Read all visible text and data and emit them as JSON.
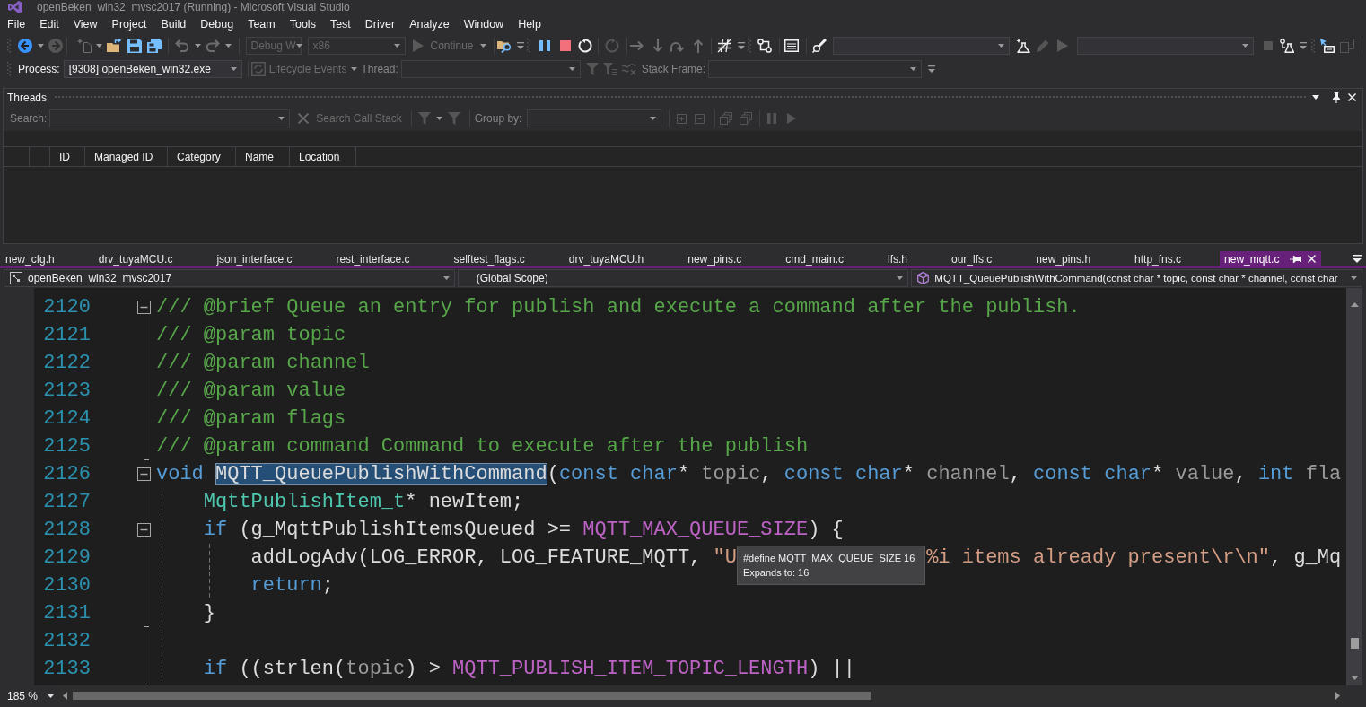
{
  "window": {
    "title": "openBeken_win32_mvsc2017 (Running) - Microsoft Visual Studio"
  },
  "menu": [
    "File",
    "Edit",
    "View",
    "Project",
    "Build",
    "Debug",
    "Team",
    "Tools",
    "Test",
    "Driver",
    "Analyze",
    "Window",
    "Help"
  ],
  "toolbar": {
    "configuration": {
      "value": "Debug W",
      "disabled": true
    },
    "platform": {
      "value": "x86",
      "disabled": true
    },
    "continue": {
      "label": "Continue",
      "disabled": true
    }
  },
  "debug_location": {
    "process": {
      "label": "Process:",
      "value": "[9308] openBeken_win32.exe",
      "disabled": false
    },
    "lifecycle_events": {
      "label": "Lifecycle Events",
      "disabled": true
    },
    "thread": {
      "label": "Thread:",
      "disabled": true
    },
    "stack_frame": {
      "label": "Stack Frame:",
      "disabled": true
    }
  },
  "threads": {
    "title": "Threads",
    "search": {
      "label": "Search:",
      "disabled": true
    },
    "search_call_stack": {
      "label": "Search Call Stack",
      "disabled": true
    },
    "group_by": {
      "label": "Group by:",
      "disabled": true
    },
    "columns": [
      "ID",
      "Managed ID",
      "Category",
      "Name",
      "Location"
    ]
  },
  "tabs": [
    {
      "label": "new_cfg.h",
      "selected": false
    },
    {
      "label": "drv_tuyaMCU.c",
      "selected": false
    },
    {
      "label": "json_interface.c",
      "selected": false
    },
    {
      "label": "rest_interface.c",
      "selected": false
    },
    {
      "label": "selftest_flags.c",
      "selected": false
    },
    {
      "label": "drv_tuyaMCU.h",
      "selected": false
    },
    {
      "label": "new_pins.c",
      "selected": false
    },
    {
      "label": "cmd_main.c",
      "selected": false
    },
    {
      "label": "lfs.h",
      "selected": false
    },
    {
      "label": "our_lfs.c",
      "selected": false
    },
    {
      "label": "new_pins.h",
      "selected": false
    },
    {
      "label": "http_fns.c",
      "selected": false
    },
    {
      "label": "new_mqtt.c",
      "selected": true
    }
  ],
  "navigation": {
    "project": "openBeken_win32_mvsc2017",
    "scope": "(Global Scope)",
    "member": "MQTT_QueuePublishWithCommand(const char * topic, const char * channel, const char"
  },
  "editor": {
    "tooltip": {
      "lines": [
        "#define MQTT_MAX_QUEUE_SIZE 16",
        "Expands to: 16"
      ]
    },
    "lines": [
      {
        "number": "2120",
        "fold_start": true,
        "fold_end": false,
        "tokens": [
          {
            "kind": "comment",
            "text": "/// @brief Queue an entry for publish and execute a command after the publish."
          }
        ]
      },
      {
        "number": "2121",
        "fold_start": false,
        "fold_end": false,
        "tokens": [
          {
            "kind": "comment",
            "text": "/// @param topic"
          }
        ]
      },
      {
        "number": "2122",
        "fold_start": false,
        "fold_end": false,
        "tokens": [
          {
            "kind": "comment",
            "text": "/// @param channel"
          }
        ]
      },
      {
        "number": "2123",
        "fold_start": false,
        "fold_end": false,
        "tokens": [
          {
            "kind": "comment",
            "text": "/// @param value"
          }
        ]
      },
      {
        "number": "2124",
        "fold_start": false,
        "fold_end": false,
        "tokens": [
          {
            "kind": "comment",
            "text": "/// @param flags"
          }
        ]
      },
      {
        "number": "2125",
        "fold_start": false,
        "fold_end": true,
        "tokens": [
          {
            "kind": "comment",
            "text": "/// @param command Command to execute after the publish"
          }
        ]
      },
      {
        "number": "2126",
        "fold_start": true,
        "fold_end": false,
        "tokens": [
          {
            "kind": "keyword",
            "text": "void "
          },
          {
            "kind": "function",
            "text": "MQTT_QueuePublishWithCommand",
            "highlighted": true
          },
          {
            "kind": "plain",
            "text": "("
          },
          {
            "kind": "keyword",
            "text": "const char"
          },
          {
            "kind": "plain",
            "text": "* "
          },
          {
            "kind": "param",
            "text": "topic"
          },
          {
            "kind": "plain",
            "text": ", "
          },
          {
            "kind": "keyword",
            "text": "const char"
          },
          {
            "kind": "plain",
            "text": "* "
          },
          {
            "kind": "param",
            "text": "channel"
          },
          {
            "kind": "plain",
            "text": ", "
          },
          {
            "kind": "keyword",
            "text": "const char"
          },
          {
            "kind": "plain",
            "text": "* "
          },
          {
            "kind": "param",
            "text": "value"
          },
          {
            "kind": "plain",
            "text": ", "
          },
          {
            "kind": "keyword",
            "text": "int "
          },
          {
            "kind": "param",
            "text": "fla"
          }
        ]
      },
      {
        "number": "2127",
        "fold_start": false,
        "fold_end": false,
        "tokens": [
          {
            "kind": "type",
            "text": "    MqttPublishItem_t"
          },
          {
            "kind": "plain",
            "text": "* newItem;"
          }
        ]
      },
      {
        "number": "2128",
        "fold_start": true,
        "fold_end": false,
        "tokens": [
          {
            "kind": "keyword",
            "text": "    if"
          },
          {
            "kind": "plain",
            "text": " (g_MqttPublishItemsQueued >= "
          },
          {
            "kind": "macro",
            "text": "MQTT_MAX_QUEUE_SIZE"
          },
          {
            "kind": "plain",
            "text": ") {"
          }
        ]
      },
      {
        "number": "2129",
        "fold_start": false,
        "fold_end": false,
        "tokens": [
          {
            "kind": "plain",
            "text": "        addLogAdv(LOG_ERROR, LOG_FEATURE_MQTT, "
          },
          {
            "kind": "string",
            "text": "\"U"
          }
        ],
        "tokens_after_tooltip": [
          {
            "kind": "string",
            "text": "%i items already present\\r\\n\""
          },
          {
            "kind": "plain",
            "text": ", g_Mq"
          }
        ]
      },
      {
        "number": "2130",
        "fold_start": false,
        "fold_end": false,
        "tokens": [
          {
            "kind": "keyword",
            "text": "        return"
          },
          {
            "kind": "plain",
            "text": ";"
          }
        ]
      },
      {
        "number": "2131",
        "fold_start": false,
        "fold_end": true,
        "tokens": [
          {
            "kind": "plain",
            "text": "    }"
          }
        ]
      },
      {
        "number": "2132",
        "fold_start": false,
        "fold_end": false
      },
      {
        "number": "2133",
        "fold_start": false,
        "fold_end": false,
        "tokens": [
          {
            "kind": "keyword",
            "text": "    if"
          },
          {
            "kind": "plain",
            "text": " ((strlen("
          },
          {
            "kind": "param",
            "text": "topic"
          },
          {
            "kind": "plain",
            "text": ") > "
          },
          {
            "kind": "macro",
            "text": "MQTT_PUBLISH_ITEM_TOPIC_LENGTH"
          },
          {
            "kind": "plain",
            "text": ") ||"
          }
        ]
      }
    ]
  },
  "status_bar": {
    "zoom": "185 %"
  }
}
